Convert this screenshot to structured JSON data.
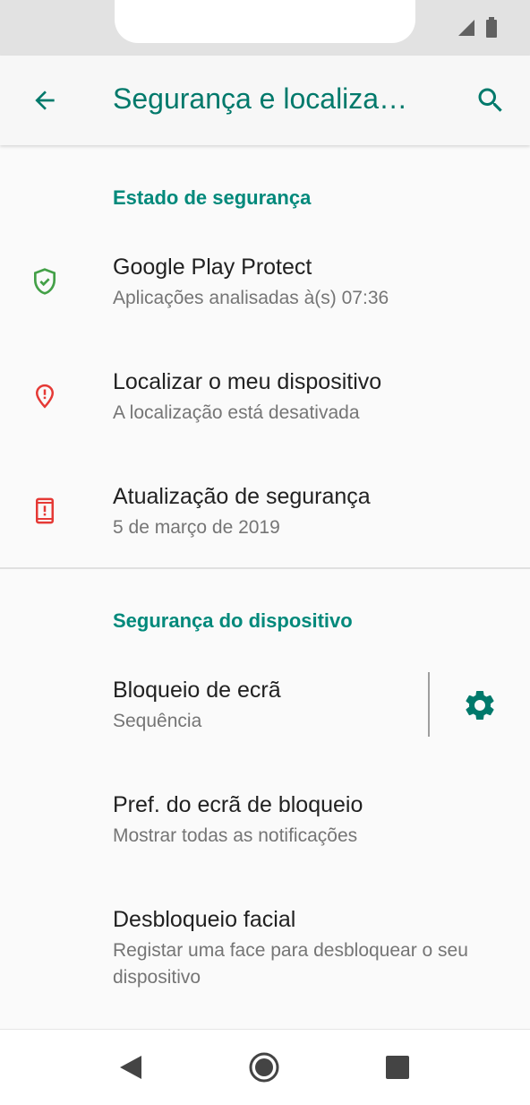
{
  "app_bar": {
    "title": "Segurança e localiza…",
    "back_icon": "arrow-back-icon",
    "search_icon": "search-icon"
  },
  "sections": {
    "security_status": {
      "header": "Estado de segurança",
      "items": [
        {
          "title": "Google Play Protect",
          "subtitle": "Aplicações analisadas à(s) 07:36",
          "icon": "shield-check-icon",
          "icon_color": "#43a047"
        },
        {
          "title": "Localizar o meu dispositivo",
          "subtitle": "A localização está desativada",
          "icon": "location-alert-icon",
          "icon_color": "#e53935"
        },
        {
          "title": "Atualização de segurança",
          "subtitle": "5 de março de 2019",
          "icon": "phone-alert-icon",
          "icon_color": "#e53935"
        }
      ]
    },
    "device_security": {
      "header": "Segurança do dispositivo",
      "items": [
        {
          "title": "Bloqueio de ecrã",
          "subtitle": "Sequência",
          "action_icon": "gear-icon"
        },
        {
          "title": "Pref. do ecrã de bloqueio",
          "subtitle": "Mostrar todas as notificações"
        },
        {
          "title": "Desbloqueio facial",
          "subtitle": "Registar uma face para desbloquear o seu dispositivo"
        }
      ]
    }
  },
  "colors": {
    "accent": "#00796b",
    "section_header": "#00897b",
    "primary_text": "#212121",
    "secondary_text": "#757575"
  },
  "navigation_bar": {
    "back": "nav-back-icon",
    "home": "nav-home-icon",
    "recents": "nav-recents-icon"
  }
}
